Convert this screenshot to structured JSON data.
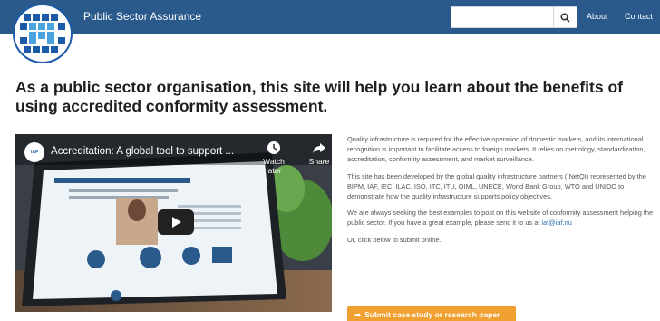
{
  "header": {
    "brand": "Public Sector Assurance",
    "search_placeholder": "",
    "search_icon": "search-icon",
    "nav": {
      "about": "About",
      "contact": "Contact"
    },
    "colors": {
      "bar": "#2a5a8c",
      "logo_blue": "#1b5aa6"
    }
  },
  "headline": "As a public sector organisation, this site will help you learn about the benefits of using accredited conformity assessment.",
  "video": {
    "title": "Accreditation: A global tool to support ...",
    "channel_logo_text": "IAF",
    "watch_later": "Watch later",
    "share": "Share",
    "screen_text": "As a public sector organisation, this site will help you learn about the benefits of using accredited conformity assessment.",
    "play_icon": "play-icon"
  },
  "body": {
    "p1": "Quality infrastructure is required for the effective operation of domestic markets, and its international recognition is important to facilitate access to foreign markets. It relies on metrology, standardization, accreditation, conformity assessment, and market surveillance.",
    "p2": "This site has been developed by the global quality infrastructure partners (INetQI) represented by the BIPM, IAF, IEC, ILAC, ISO, ITC, ITU, OIML, UNECE, World Bank Group, WTO and UNIDO to demonstrate how the quality infrastructure supports policy objectives.",
    "p3_prefix": "We are always seeking the best examples to post on this website of conformity assessment helping the public sector. If you have a great example, please send it to us at ",
    "email": "iaf@iaf.nu",
    "p4": "Or, click below to submit online.",
    "submit_label": "Submit case study or research paper",
    "submit_color": "#f0a030"
  }
}
